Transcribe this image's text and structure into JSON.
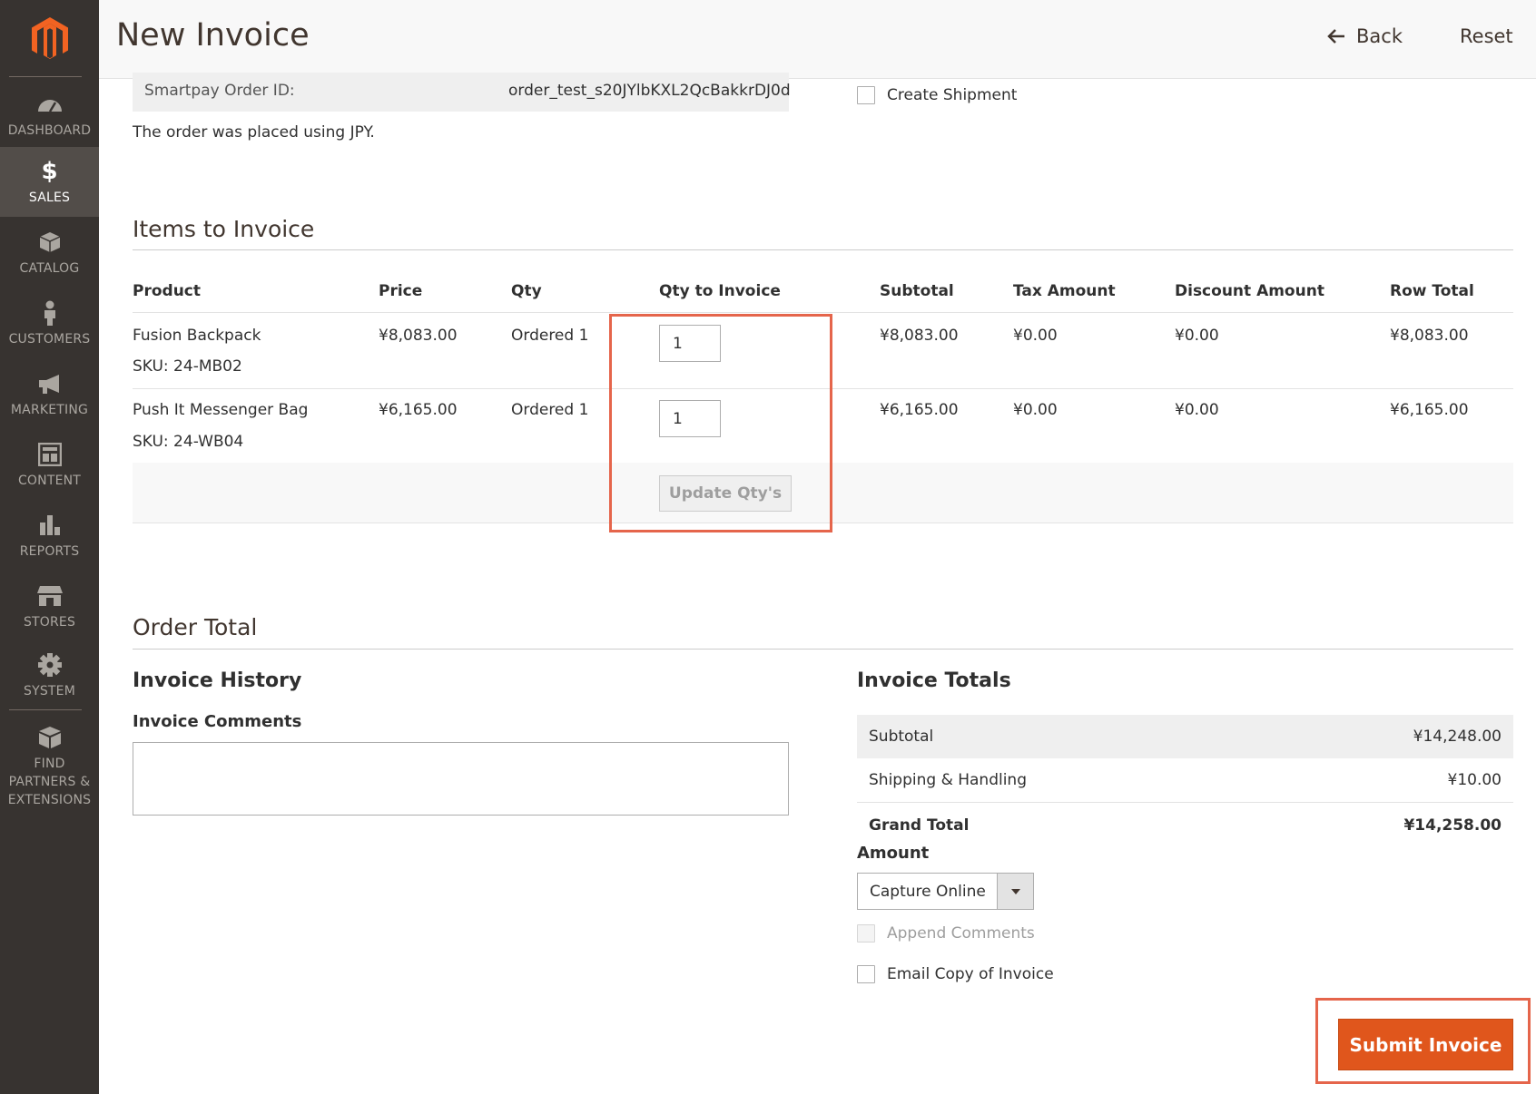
{
  "header": {
    "title": "New Invoice",
    "back_label": "Back",
    "reset_label": "Reset"
  },
  "sidebar": {
    "items": [
      {
        "label": "DASHBOARD",
        "icon": "dashboard-icon"
      },
      {
        "label": "SALES",
        "icon": "dollar-icon",
        "active": true
      },
      {
        "label": "CATALOG",
        "icon": "box-icon"
      },
      {
        "label": "CUSTOMERS",
        "icon": "person-icon"
      },
      {
        "label": "MARKETING",
        "icon": "megaphone-icon"
      },
      {
        "label": "CONTENT",
        "icon": "layout-icon"
      },
      {
        "label": "REPORTS",
        "icon": "bar-chart-icon"
      },
      {
        "label": "STORES",
        "icon": "storefront-icon"
      },
      {
        "label": "SYSTEM",
        "icon": "gear-icon"
      },
      {
        "label_lines": [
          "FIND",
          "PARTNERS &",
          "EXTENSIONS"
        ],
        "icon": "blocks-icon"
      }
    ]
  },
  "order_info": {
    "smartpay_label": "Smartpay Order ID:",
    "smartpay_value": "order_test_s20JYlbKXL2QcBakkrDJ0d",
    "currency_note": "The order was placed using JPY.",
    "create_shipment_label": "Create Shipment"
  },
  "items": {
    "title": "Items to Invoice",
    "columns": [
      "Product",
      "Price",
      "Qty",
      "Qty to Invoice",
      "Subtotal",
      "Tax Amount",
      "Discount Amount",
      "Row Total"
    ],
    "rows": [
      {
        "product": "Fusion Backpack",
        "sku": "SKU: 24-MB02",
        "price": "¥8,083.00",
        "qty": "Ordered 1",
        "qty_to_invoice": "1",
        "subtotal": "¥8,083.00",
        "tax": "¥0.00",
        "discount": "¥0.00",
        "row_total": "¥8,083.00"
      },
      {
        "product": "Push It Messenger Bag",
        "sku": "SKU: 24-WB04",
        "price": "¥6,165.00",
        "qty": "Ordered 1",
        "qty_to_invoice": "1",
        "subtotal": "¥6,165.00",
        "tax": "¥0.00",
        "discount": "¥0.00",
        "row_total": "¥6,165.00"
      }
    ],
    "update_label": "Update Qty's"
  },
  "order_total": {
    "title": "Order Total",
    "history_title": "Invoice History",
    "comments_label": "Invoice Comments",
    "comments_value": "",
    "totals_title": "Invoice Totals",
    "subtotal_label": "Subtotal",
    "subtotal_value": "¥14,248.00",
    "shipping_label": "Shipping & Handling",
    "shipping_value": "¥10.00",
    "grand_label": "Grand Total",
    "grand_value": "¥14,258.00",
    "amount_label": "Amount",
    "amount_selected": "Capture Online",
    "append_label": "Append Comments",
    "email_label": "Email Copy of Invoice",
    "submit_label": "Submit Invoice"
  },
  "colors": {
    "sidebar_bg": "#373330",
    "sidebar_active": "#524d49",
    "accent": "#e0561c",
    "highlight": "#e5654b",
    "logo": "#f26322"
  }
}
